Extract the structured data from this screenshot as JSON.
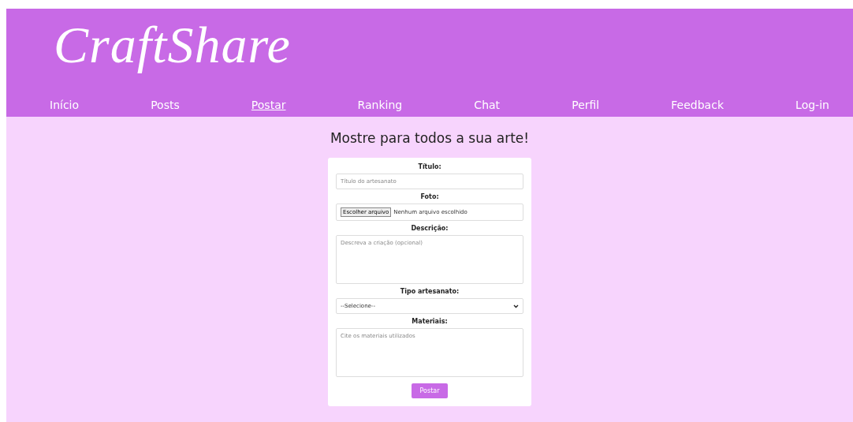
{
  "logo": "CraftShare",
  "nav": [
    {
      "label": "Início",
      "selected": false
    },
    {
      "label": "Posts",
      "selected": false
    },
    {
      "label": "Postar",
      "selected": true
    },
    {
      "label": "Ranking",
      "selected": false
    },
    {
      "label": "Chat",
      "selected": false
    },
    {
      "label": "Perfil",
      "selected": false
    },
    {
      "label": "Feedback",
      "selected": false
    },
    {
      "label": "Log-in",
      "selected": false
    }
  ],
  "heading": "Mostre para todos a sua arte!",
  "form": {
    "fields": [
      {
        "kind": "text",
        "label": "Título:",
        "placeholder": "Título do artesanato"
      },
      {
        "kind": "file",
        "label": "Foto:",
        "button": "Escolher arquivo",
        "status": "Nenhum arquivo escolhido"
      },
      {
        "kind": "textarea",
        "label": "Descrição:",
        "placeholder": "Descreva a criação (opcional)"
      },
      {
        "kind": "select",
        "label": "Tipo artesanato:",
        "value": "--Selecione--"
      },
      {
        "kind": "textarea",
        "label": "Materiais:",
        "placeholder": "Cite os materiais utilizados"
      }
    ],
    "submit": "Postar"
  }
}
